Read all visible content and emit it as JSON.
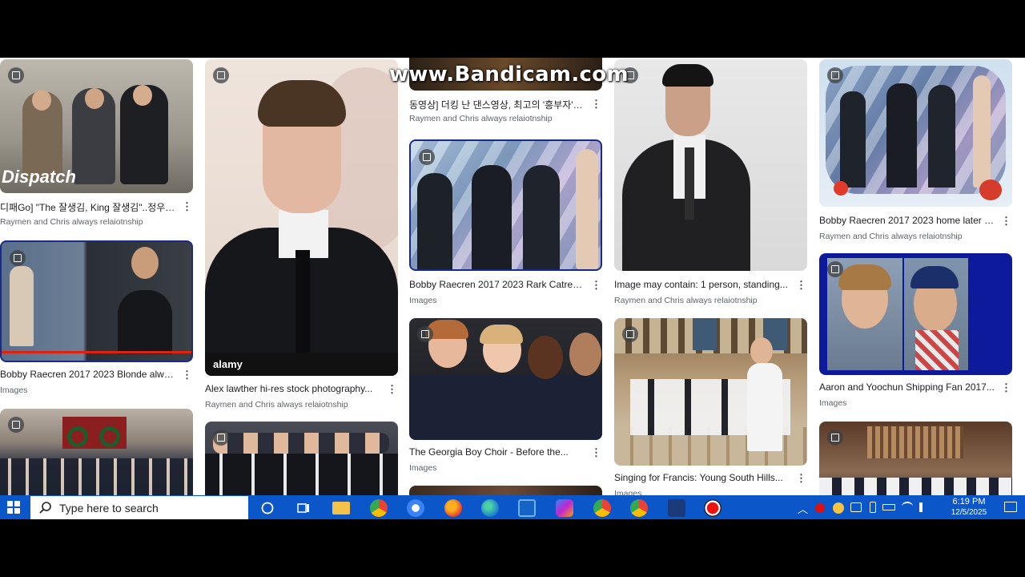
{
  "watermark": "www.Bandicam.com",
  "results": [
    {
      "title": "디패Go] \"The 잘생김, King 잘생김\"..정우성x...",
      "source": "Raymen and Chris always relaiotnship",
      "thumb_text": "Dispatch"
    },
    {
      "title": "Bobby Raecren 2017 2023 Blonde alway...",
      "source": "Images"
    },
    {
      "title": "Alex lawther hi-res stock photography...",
      "source": "Raymen and Chris always relaiotnship",
      "thumb_text": "alamy"
    },
    {
      "title": "동영상] 더킹 난 댄스영상, 최고의 '흥부자'는 ...",
      "source": "Raymen and Chris always relaiotnship"
    },
    {
      "title": "Bobby Raecren 2017 2023 Rark Catren b...",
      "source": "Images"
    },
    {
      "title": "The Georgia Boy Choir - Before the...",
      "source": "Images"
    },
    {
      "title": "Image may contain: 1 person, standing...",
      "source": "Raymen and Chris always relaiotnship"
    },
    {
      "title": "Singing for Francis: Young South Hills...",
      "source": "Images"
    },
    {
      "title": "Bobby Raecren 2017 2023 home later stil...",
      "source": "Raymen and Chris always relaiotnship"
    },
    {
      "title": "Aaron and Yoochun Shipping Fan 2017...",
      "source": "Images"
    }
  ],
  "taskbar": {
    "search_placeholder": "Type here to search",
    "time": "6:19 PM",
    "date": "12/5/2025"
  },
  "colors": {
    "taskbar": "#0b56c9",
    "title_text": "#202124",
    "source_text": "#5f6368"
  }
}
